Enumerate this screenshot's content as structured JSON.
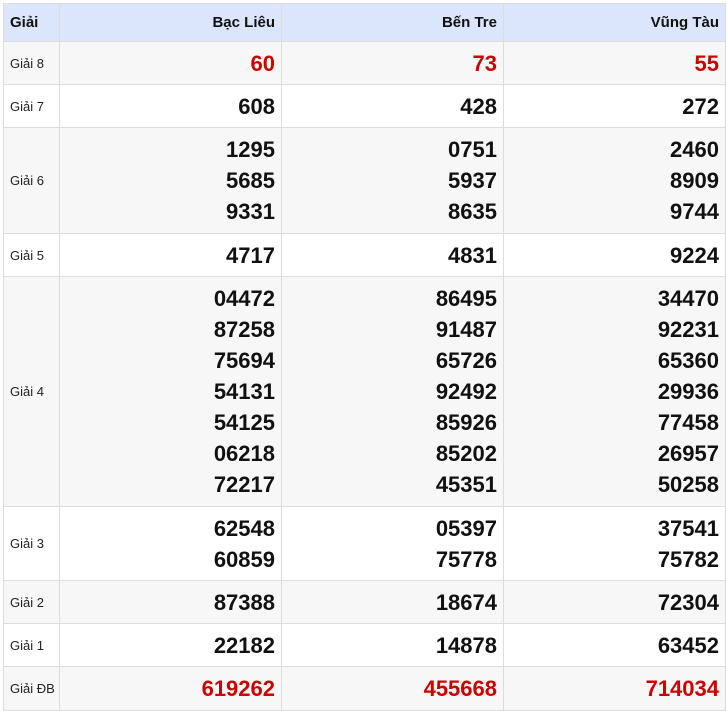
{
  "header": {
    "label": "Giải",
    "provinces": [
      "Bạc Liêu",
      "Bến Tre",
      "Vũng Tàu"
    ]
  },
  "prizes": [
    {
      "label": "Giải 8",
      "highlight": true,
      "values": [
        [
          "60"
        ],
        [
          "73"
        ],
        [
          "55"
        ]
      ]
    },
    {
      "label": "Giải 7",
      "highlight": false,
      "values": [
        [
          "608"
        ],
        [
          "428"
        ],
        [
          "272"
        ]
      ]
    },
    {
      "label": "Giải 6",
      "highlight": false,
      "values": [
        [
          "1295",
          "5685",
          "9331"
        ],
        [
          "0751",
          "5937",
          "8635"
        ],
        [
          "2460",
          "8909",
          "9744"
        ]
      ]
    },
    {
      "label": "Giải 5",
      "highlight": false,
      "values": [
        [
          "4717"
        ],
        [
          "4831"
        ],
        [
          "9224"
        ]
      ]
    },
    {
      "label": "Giải 4",
      "highlight": false,
      "values": [
        [
          "04472",
          "87258",
          "75694",
          "54131",
          "54125",
          "06218",
          "72217"
        ],
        [
          "86495",
          "91487",
          "65726",
          "92492",
          "85926",
          "85202",
          "45351"
        ],
        [
          "34470",
          "92231",
          "65360",
          "29936",
          "77458",
          "26957",
          "50258"
        ]
      ]
    },
    {
      "label": "Giải 3",
      "highlight": false,
      "values": [
        [
          "62548",
          "60859"
        ],
        [
          "05397",
          "75778"
        ],
        [
          "37541",
          "75782"
        ]
      ]
    },
    {
      "label": "Giải 2",
      "highlight": false,
      "values": [
        [
          "87388"
        ],
        [
          "18674"
        ],
        [
          "72304"
        ]
      ]
    },
    {
      "label": "Giải 1",
      "highlight": false,
      "values": [
        [
          "22182"
        ],
        [
          "14878"
        ],
        [
          "63452"
        ]
      ]
    },
    {
      "label": "Giải ĐB",
      "highlight": true,
      "values": [
        [
          "619262"
        ],
        [
          "455668"
        ],
        [
          "714034"
        ]
      ]
    }
  ],
  "colors": {
    "header_bg": "#dbe6fc",
    "highlight": "#cc0000",
    "border": "#dcdcdc"
  }
}
